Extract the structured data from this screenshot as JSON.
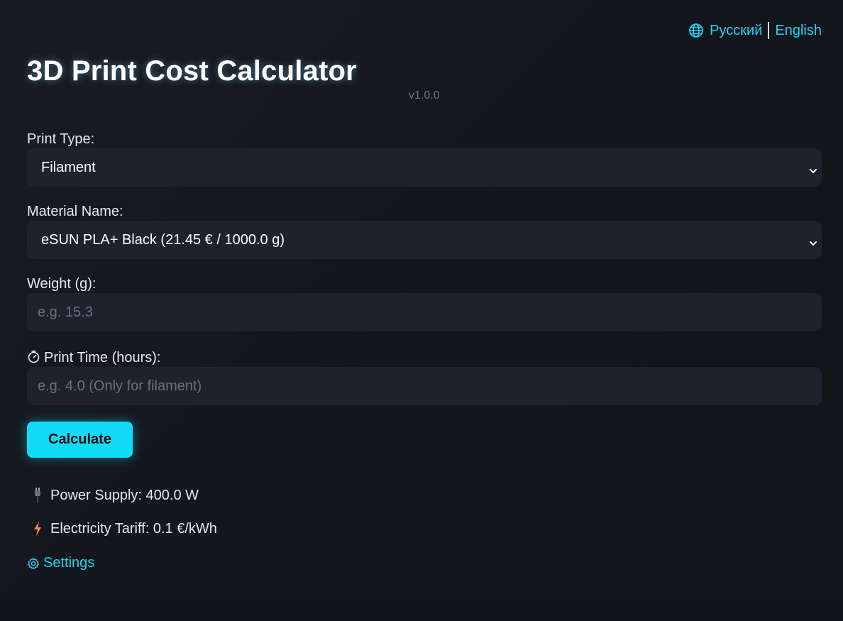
{
  "app": {
    "title": "3D Print Cost Calculator",
    "version": "v1.0.0"
  },
  "language": {
    "icon": "globe-icon",
    "options": [
      "Русский",
      "English"
    ]
  },
  "form": {
    "print_type": {
      "label": "Print Type:",
      "value": "Filament"
    },
    "material": {
      "label": "Material Name:",
      "value": "eSUN PLA+ Black (21.45 € / 1000.0 g)"
    },
    "weight": {
      "label": "Weight (g):",
      "placeholder": "e.g. 15.3",
      "value": ""
    },
    "print_time": {
      "icon": "stopwatch-icon",
      "label": "Print Time (hours):",
      "placeholder": "e.g. 4.0 (Only for filament)",
      "value": ""
    },
    "calculate_label": "Calculate"
  },
  "info": {
    "power_supply": {
      "icon": "plug-icon",
      "text": "Power Supply: 400.0 W"
    },
    "electricity_tariff": {
      "icon": "lightning-icon",
      "text": "Electricity Tariff: 0.1 €/kWh"
    }
  },
  "settings": {
    "icon": "gear-icon",
    "label": "Settings"
  },
  "colors": {
    "background": "#14161d",
    "field_background": "#1f222d",
    "accent": "#12dcf5",
    "link": "#1fd2f0",
    "lightning": "#f0884a"
  }
}
